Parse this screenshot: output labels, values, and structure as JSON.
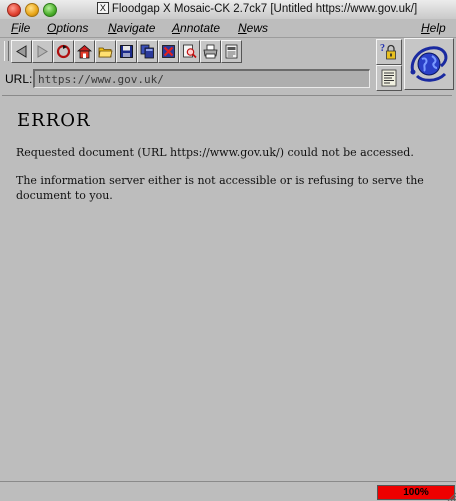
{
  "window": {
    "title_badge": "X",
    "title": "Floodgap X Mosaic-CK 2.7ck7 [Untitled https://www.gov.uk/]"
  },
  "menus": [
    {
      "first": "F",
      "rest": "ile"
    },
    {
      "first": "O",
      "rest": "ptions"
    },
    {
      "first": "N",
      "rest": "avigate"
    },
    {
      "first": "A",
      "rest": "nnotate"
    },
    {
      "first": "N",
      "rest": "ews"
    },
    {
      "first": "H",
      "rest": "elp"
    }
  ],
  "toolbar": {
    "buttons": [
      "back-icon",
      "forward-icon",
      "reload-icon",
      "home-icon",
      "open-folder-icon",
      "save-icon",
      "new-window-icon",
      "close-window-icon",
      "find-icon",
      "print-icon",
      "page-setup-icon"
    ]
  },
  "url": {
    "label": "URL:",
    "value": "https://www.gov.uk/"
  },
  "content": {
    "heading": "ERROR",
    "line1": "Requested document (URL https://www.gov.uk/) could not be accessed.",
    "line2": "The information server either is not accessible or is refusing to serve the document to you."
  },
  "status": {
    "progress_text": "100%",
    "progress_fraction": 1.0
  },
  "colors": {
    "progress": "#ee0000",
    "chrome": "#bdbdbd"
  }
}
